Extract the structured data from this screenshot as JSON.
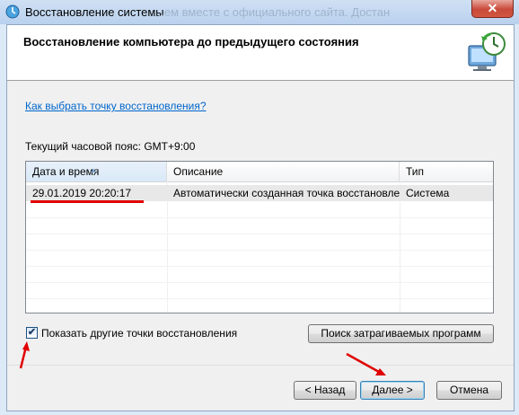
{
  "window": {
    "title": "Восстановление системы",
    "background_title_text": "...ем вместе с официального сайта. Достан",
    "close_symbol": "✕"
  },
  "header": {
    "title": "Восстановление компьютера до предыдущего состояния",
    "icon": "system-restore-icon"
  },
  "help_link": "Как выбрать точку восстановления?",
  "timezone_label": "Текущий часовой пояс: GMT+9:00",
  "table": {
    "columns": [
      "Дата и время",
      "Описание",
      "Тип"
    ],
    "rows": [
      {
        "datetime": "29.01.2019 20:20:17",
        "description": "Автоматически созданная точка восстановле...",
        "type": "Система"
      }
    ]
  },
  "checkbox": {
    "label": "Показать другие точки восстановления",
    "checked": true,
    "check_symbol": "✔"
  },
  "buttons": {
    "search": "Поиск затрагиваемых программ",
    "back": "< Назад",
    "next": "Далее >",
    "cancel": "Отмена"
  },
  "colors": {
    "annotation": "#e00000",
    "link": "#0066cc"
  }
}
